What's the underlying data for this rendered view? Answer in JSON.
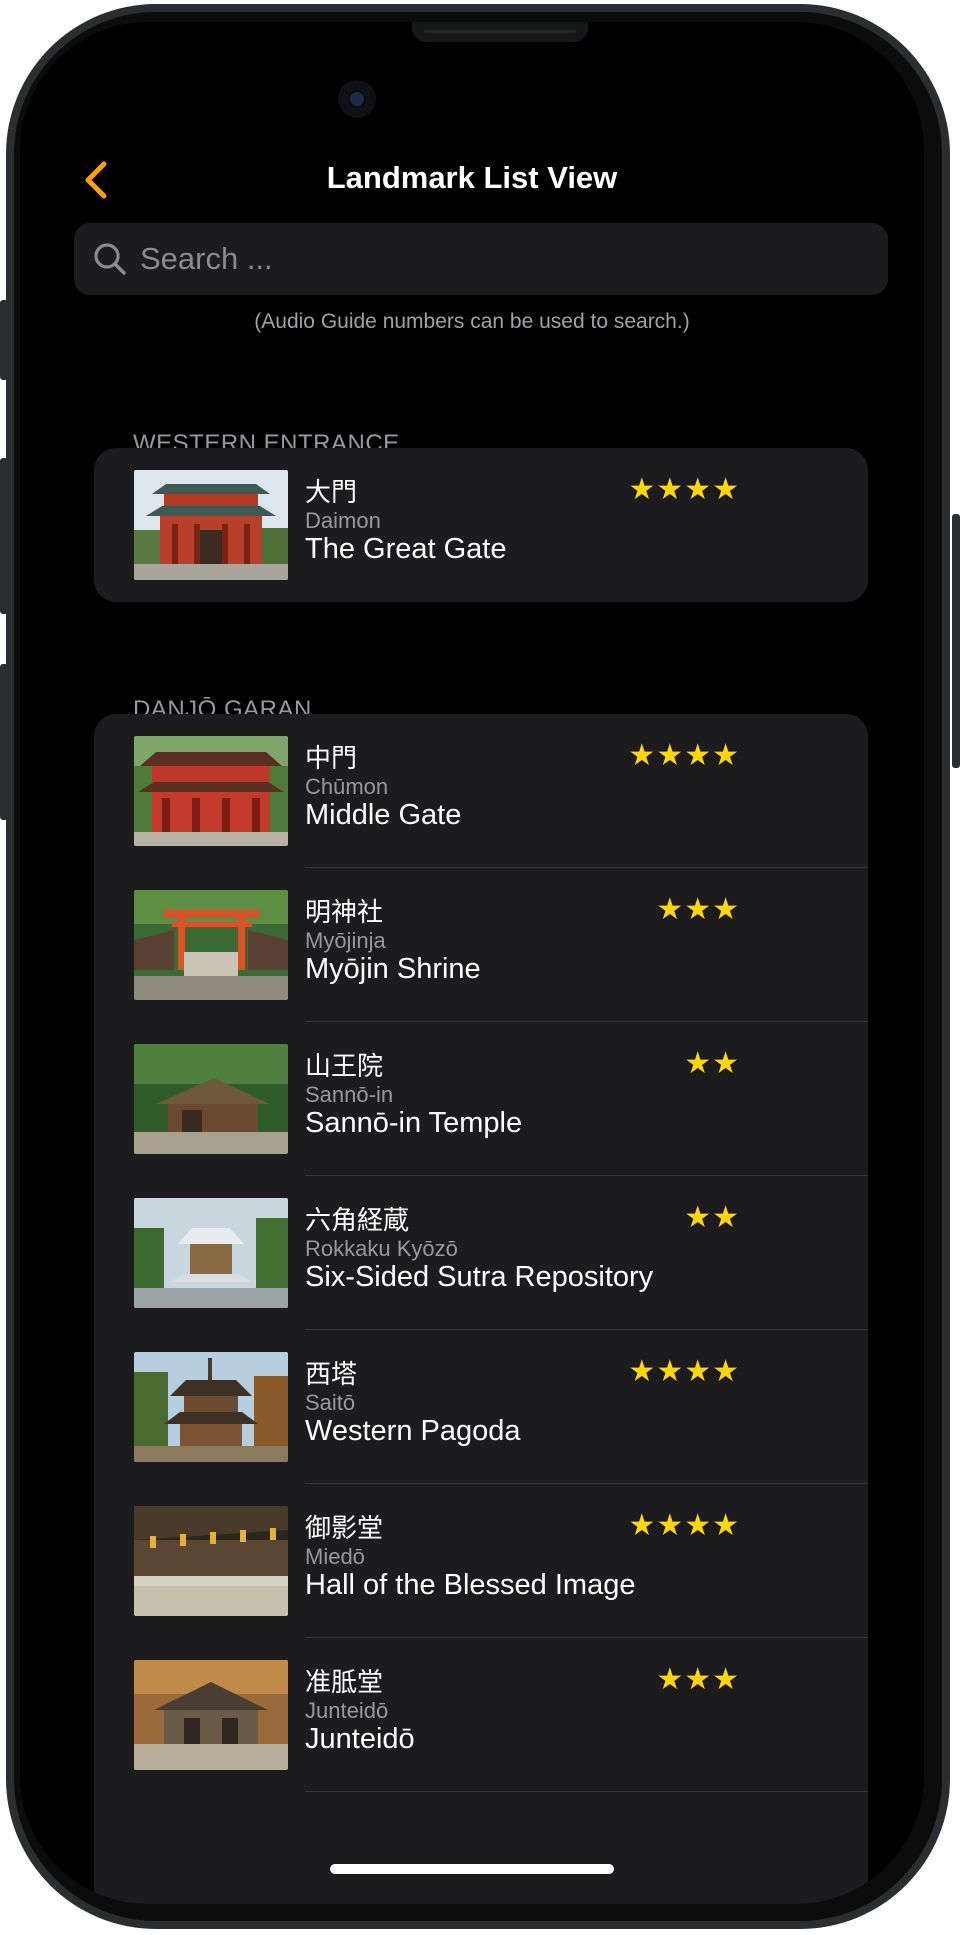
{
  "header": {
    "title": "Landmark List View"
  },
  "search": {
    "placeholder": "Search ...",
    "hint": "(Audio Guide numbers can be used to search.)"
  },
  "sections": [
    {
      "title": "WESTERN ENTRANCE",
      "items": [
        {
          "jp": "大門",
          "romaji": "Daimon",
          "en": "The Great Gate",
          "rating": 4,
          "stars": "★★★★"
        }
      ]
    },
    {
      "title": "DANJŌ GARAN",
      "items": [
        {
          "jp": "中門",
          "romaji": "Chūmon",
          "en": "Middle Gate",
          "rating": 4,
          "stars": "★★★★"
        },
        {
          "jp": "明神社",
          "romaji": "Myōjinja",
          "en": "Myōjin Shrine",
          "rating": 3,
          "stars": "★★★"
        },
        {
          "jp": "山王院",
          "romaji": "Sannō-in",
          "en": "Sannō-in Temple",
          "rating": 2,
          "stars": "★★"
        },
        {
          "jp": "六角経蔵",
          "romaji": "Rokkaku Kyōzō",
          "en": "Six-Sided Sutra Repository",
          "rating": 2,
          "stars": "★★"
        },
        {
          "jp": "西塔",
          "romaji": "Saitō",
          "en": "Western Pagoda",
          "rating": 4,
          "stars": "★★★★"
        },
        {
          "jp": "御影堂",
          "romaji": "Miedō",
          "en": "Hall of the Blessed Image",
          "rating": 4,
          "stars": "★★★★"
        },
        {
          "jp": "准胝堂",
          "romaji": "Junteidō",
          "en": "Junteidō",
          "rating": 3,
          "stars": "★★★"
        }
      ]
    }
  ],
  "colors": {
    "accent": "#ff9f0a",
    "star": "#ffd60a",
    "background": "#000000",
    "card": "#1c1c1e"
  }
}
